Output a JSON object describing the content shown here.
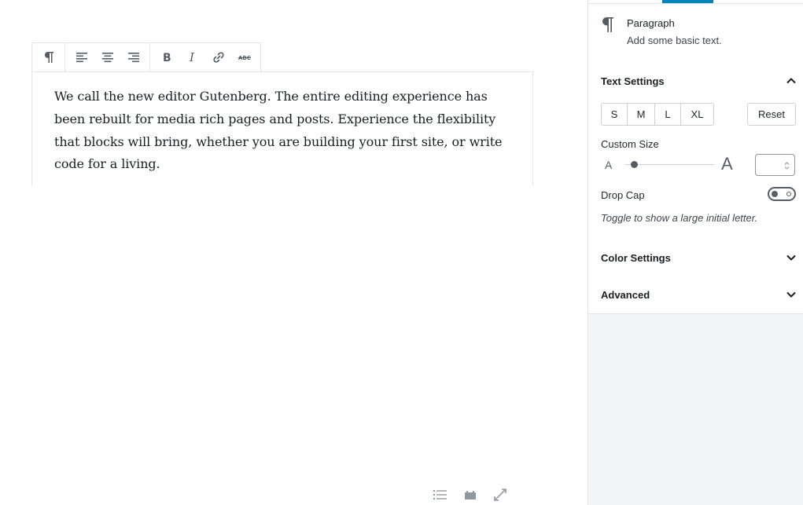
{
  "editor": {
    "toolbar": {
      "block_type_icon": "paragraph-icon",
      "align_icons": [
        "align-left-icon",
        "align-center-icon",
        "align-right-icon"
      ],
      "format_icons": [
        "bold-icon",
        "italic-icon",
        "link-icon",
        "strikethrough-icon"
      ]
    },
    "paragraph_text": "We call the new editor Gutenberg. The entire editing experience has been rebuilt for media rich pages and posts. Experience the flexibility that blocks will bring, whether you are building your first site, or write code for a living.",
    "footer_icons": [
      "list-view-icon",
      "block-icon",
      "fullscreen-icon"
    ]
  },
  "sidebar": {
    "accent": "#0085ba",
    "block_card": {
      "icon": "paragraph-icon",
      "title": "Paragraph",
      "description": "Add some basic text."
    },
    "text_settings": {
      "title": "Text Settings",
      "expanded": true,
      "sizes": [
        "S",
        "M",
        "L",
        "XL"
      ],
      "reset_label": "Reset",
      "custom_size_label": "Custom Size",
      "range_small_label": "A",
      "range_large_label": "A",
      "custom_size_value": "",
      "drop_cap_label": "Drop Cap",
      "drop_cap_enabled": false,
      "drop_cap_help": "Toggle to show a large initial letter."
    },
    "color_settings": {
      "title": "Color Settings",
      "expanded": false
    },
    "advanced": {
      "title": "Advanced",
      "expanded": false
    }
  }
}
